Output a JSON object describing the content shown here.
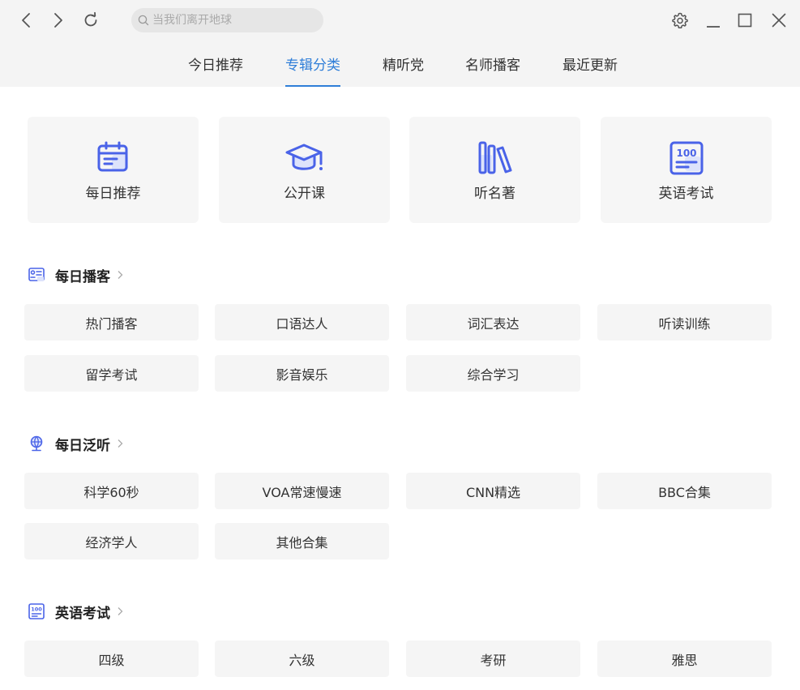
{
  "search": {
    "placeholder": "当我们离开地球"
  },
  "tabs": [
    {
      "label": "今日推荐"
    },
    {
      "label": "专辑分类",
      "active": true
    },
    {
      "label": "精听党"
    },
    {
      "label": "名师播客"
    },
    {
      "label": "最近更新"
    }
  ],
  "categories": [
    {
      "label": "每日推荐",
      "icon": "calendar-icon"
    },
    {
      "label": "公开课",
      "icon": "graduation-cap-icon"
    },
    {
      "label": "听名著",
      "icon": "books-icon"
    },
    {
      "label": "英语考试",
      "icon": "exam-100-icon"
    }
  ],
  "sections": [
    {
      "title": "每日播客",
      "icon": "podcast-card-icon",
      "items": [
        "热门播客",
        "口语达人",
        "词汇表达",
        "听读训练",
        "留学考试",
        "影音娱乐",
        "综合学习"
      ]
    },
    {
      "title": "每日泛听",
      "icon": "globe-icon",
      "items": [
        "科学60秒",
        "VOA常速慢速",
        "CNN精选",
        "BBC合集",
        "经济学人",
        "其他合集"
      ]
    },
    {
      "title": "英语考试",
      "icon": "exam-100-icon",
      "items": [
        "四级",
        "六级",
        "考研",
        "雅思"
      ]
    }
  ],
  "colors": {
    "accent": "#2f7ed8",
    "icon_blue": "#4a63e8",
    "icon_light": "#dde3fb"
  }
}
